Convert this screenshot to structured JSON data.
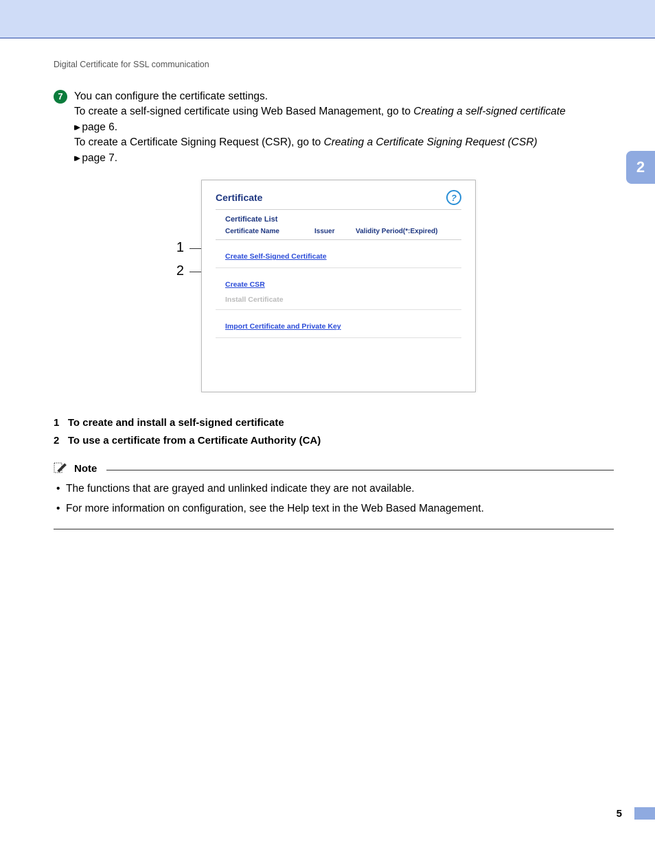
{
  "header": {
    "title": "Digital Certificate for SSL communication"
  },
  "chapter": {
    "number": "2"
  },
  "step": {
    "number": "7",
    "line1": "You can configure the certificate settings.",
    "line2_a": "To create a self-signed certificate using Web Based Management, go to ",
    "line2_b": "Creating a self-signed certificate",
    "line2_c": " page 6.",
    "line3_a": "To create a Certificate Signing Request (CSR), go to ",
    "line3_b": "Creating a Certificate Signing Request (CSR)",
    "line3_c": " page 7."
  },
  "panel": {
    "title": "Certificate",
    "list_heading": "Certificate List",
    "col1": "Certificate Name",
    "col2": "Issuer",
    "col3": "Validity Period(*:Expired)",
    "action_create_self": "Create Self-Signed Certificate",
    "action_create_csr": "Create CSR",
    "action_install": "Install Certificate",
    "action_import": "Import Certificate and Private Key",
    "callout_1": "1",
    "callout_2": "2"
  },
  "legend": {
    "item1_num": "1",
    "item1_text": "To create and install a self-signed certificate",
    "item2_num": "2",
    "item2_text": "To use a certificate from a Certificate Authority (CA)"
  },
  "note": {
    "label": "Note",
    "bullet1": "The functions that are grayed and unlinked indicate they are not available.",
    "bullet2": "For more information on configuration, see the Help text in the Web Based Management."
  },
  "page": {
    "number": "5"
  }
}
